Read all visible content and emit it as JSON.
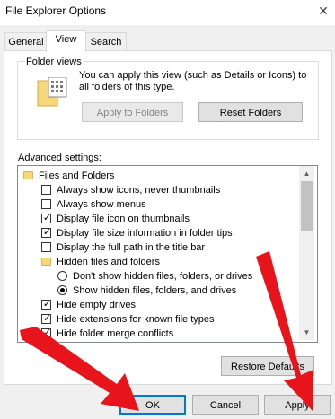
{
  "window": {
    "title": "File Explorer Options",
    "close_glyph": "✕"
  },
  "tabs": [
    {
      "label": "General",
      "active": false
    },
    {
      "label": "View",
      "active": true
    },
    {
      "label": "Search",
      "active": false
    }
  ],
  "folder_views": {
    "group_label": "Folder views",
    "description": "You can apply this view (such as Details or Icons) to all folders of this type.",
    "apply_button": "Apply to Folders",
    "apply_disabled": true,
    "reset_button": "Reset Folders",
    "icon": "folder-views-icon"
  },
  "advanced": {
    "label": "Advanced settings:",
    "items": [
      {
        "type": "folder",
        "label": "Files and Folders",
        "indent": 0
      },
      {
        "type": "checkbox",
        "label": "Always show icons, never thumbnails",
        "checked": false,
        "indent": 1
      },
      {
        "type": "checkbox",
        "label": "Always show menus",
        "checked": false,
        "indent": 1
      },
      {
        "type": "checkbox",
        "label": "Display file icon on thumbnails",
        "checked": true,
        "indent": 1
      },
      {
        "type": "checkbox",
        "label": "Display file size information in folder tips",
        "checked": true,
        "indent": 1
      },
      {
        "type": "checkbox",
        "label": "Display the full path in the title bar",
        "checked": false,
        "indent": 1
      },
      {
        "type": "folder",
        "label": "Hidden files and folders",
        "indent": 1
      },
      {
        "type": "radio",
        "label": "Don't show hidden files, folders, or drives",
        "checked": false,
        "indent": 2
      },
      {
        "type": "radio",
        "label": "Show hidden files, folders, and drives",
        "checked": true,
        "indent": 2
      },
      {
        "type": "checkbox",
        "label": "Hide empty drives",
        "checked": true,
        "indent": 1
      },
      {
        "type": "checkbox",
        "label": "Hide extensions for known file types",
        "checked": true,
        "indent": 1
      },
      {
        "type": "checkbox",
        "label": "Hide folder merge conflicts",
        "checked": true,
        "indent": 1
      }
    ],
    "restore_button": "Restore Defaults"
  },
  "footer": {
    "ok": "OK",
    "cancel": "Cancel",
    "apply": "Apply"
  },
  "colors": {
    "annotation_arrow": "#e8141c",
    "focus_border": "#0078d7"
  }
}
